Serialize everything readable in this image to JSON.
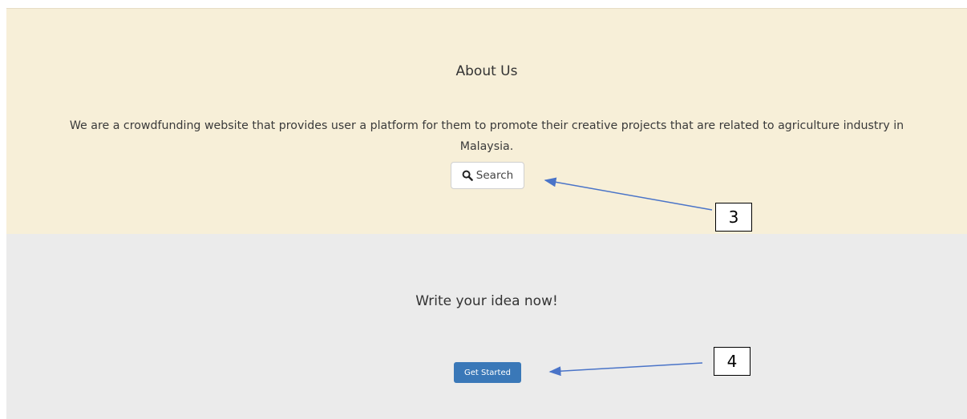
{
  "about": {
    "title": "About Us",
    "text_line1": "We are a crowdfunding website that provides user a platform for them to promote their creative projects that are related to agriculture industry in",
    "text_line2": "Malaysia.",
    "search_label": "Search"
  },
  "idea": {
    "title": "Write your idea now!",
    "button_label": "Get Started"
  },
  "annotations": [
    {
      "label": "3"
    },
    {
      "label": "4"
    }
  ],
  "icons": {
    "search": "search-icon"
  },
  "colors": {
    "about_bg": "#f7efd8",
    "idea_bg": "#ebebeb",
    "primary_button": "#3a78b8",
    "arrow": "#4a74c8"
  }
}
